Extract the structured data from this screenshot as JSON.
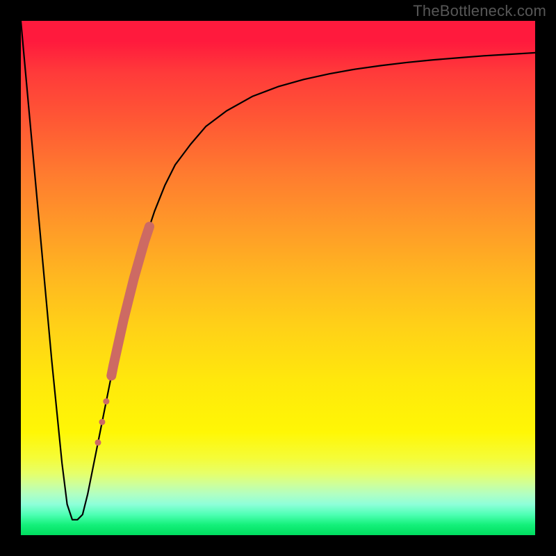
{
  "attribution": {
    "text": "TheBottleneck.com",
    "color": "#575757"
  },
  "colors": {
    "frame": "#000000",
    "curve": "#000000",
    "bead": "#cd6a63"
  },
  "chart_data": {
    "type": "line",
    "title": "",
    "xlabel": "",
    "ylabel": "",
    "xlim": [
      0,
      100
    ],
    "ylim": [
      0,
      100
    ],
    "grid": false,
    "legend": false,
    "series": [
      {
        "name": "bottleneck-curve",
        "x": [
          0,
          2,
          4,
          6,
          8,
          9,
          10,
          11,
          12,
          13,
          14,
          16,
          18,
          20,
          22,
          24,
          26,
          28,
          30,
          33,
          36,
          40,
          45,
          50,
          55,
          60,
          65,
          70,
          75,
          80,
          85,
          90,
          95,
          100
        ],
        "y": [
          100,
          78,
          56,
          34,
          14,
          6,
          3,
          3,
          4,
          8,
          13,
          23,
          33,
          42,
          50,
          57,
          63,
          68,
          72,
          76,
          79.5,
          82.5,
          85.3,
          87.2,
          88.6,
          89.7,
          90.6,
          91.3,
          91.9,
          92.4,
          92.8,
          93.2,
          93.5,
          93.8
        ]
      }
    ],
    "annotations": [
      {
        "name": "highlight-segment",
        "kind": "bead-on-curve",
        "color": "#cd6a63",
        "points": [
          {
            "x": 15.0,
            "y": 18.0,
            "r": 4.5
          },
          {
            "x": 15.8,
            "y": 22.0,
            "r": 4.5
          },
          {
            "x": 16.6,
            "y": 26.0,
            "r": 4.5
          },
          {
            "x": 17.6,
            "y": 31.0,
            "r": 6.0
          },
          {
            "x": 18.0,
            "y": 33.0,
            "r": 7.0
          },
          {
            "x": 19.0,
            "y": 37.5,
            "r": 7.0
          },
          {
            "x": 20.0,
            "y": 42.0,
            "r": 7.0
          },
          {
            "x": 21.0,
            "y": 46.0,
            "r": 7.0
          },
          {
            "x": 22.0,
            "y": 50.0,
            "r": 7.0
          },
          {
            "x": 23.0,
            "y": 53.5,
            "r": 7.0
          },
          {
            "x": 24.0,
            "y": 57.0,
            "r": 7.0
          },
          {
            "x": 25.0,
            "y": 60.0,
            "r": 6.5
          }
        ]
      }
    ]
  }
}
